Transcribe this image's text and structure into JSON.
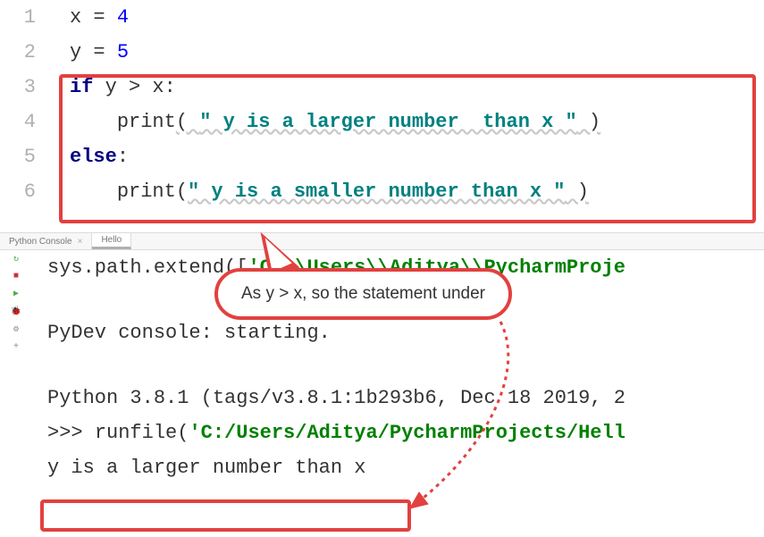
{
  "editor": {
    "lines": [
      {
        "num": "1",
        "segs": [
          {
            "t": "x = ",
            "c": ""
          },
          {
            "t": "4",
            "c": "num"
          }
        ]
      },
      {
        "num": "2",
        "segs": [
          {
            "t": "y = ",
            "c": ""
          },
          {
            "t": "5",
            "c": "num"
          }
        ]
      },
      {
        "num": "3",
        "segs": [
          {
            "t": "if",
            "c": "kw"
          },
          {
            "t": " y > x:",
            "c": ""
          }
        ]
      },
      {
        "num": "4",
        "segs": [
          {
            "t": "    ",
            "c": ""
          },
          {
            "t": "print",
            "c": "builtin"
          },
          {
            "t": "( ",
            "c": "squiggle"
          },
          {
            "t": "\" y is a larger number  than x \"",
            "c": "str squiggle"
          },
          {
            "t": " )",
            "c": "squiggle"
          }
        ]
      },
      {
        "num": "5",
        "segs": [
          {
            "t": "else",
            "c": "kw"
          },
          {
            "t": ":",
            "c": ""
          }
        ]
      },
      {
        "num": "6",
        "segs": [
          {
            "t": "    ",
            "c": ""
          },
          {
            "t": "print",
            "c": "builtin"
          },
          {
            "t": "(",
            "c": ""
          },
          {
            "t": "\" y is a smaller number than x \"",
            "c": "str squiggle"
          },
          {
            "t": " )",
            "c": "squiggle"
          }
        ]
      }
    ]
  },
  "tabs": {
    "t0": "Python Console",
    "t1": "Hello"
  },
  "console": {
    "l0a": "sys.path.extend([",
    "l0b": "'C:\\\\Users\\\\Aditya\\\\PycharmProje",
    "l1a": "PyDev console: ",
    "l1b": "starting.",
    "l2": "Python 3.8.1 (tags/v3.8.1:1b293b6, Dec 18 2019, 2",
    "l3a": ">>> ",
    "l3b": "runfile(",
    "l3c": "'C:/Users/Aditya/PycharmProjects/Hell",
    "l4": " y is a larger number  than x "
  },
  "callout": {
    "text": "As y > x, so the statement under"
  }
}
